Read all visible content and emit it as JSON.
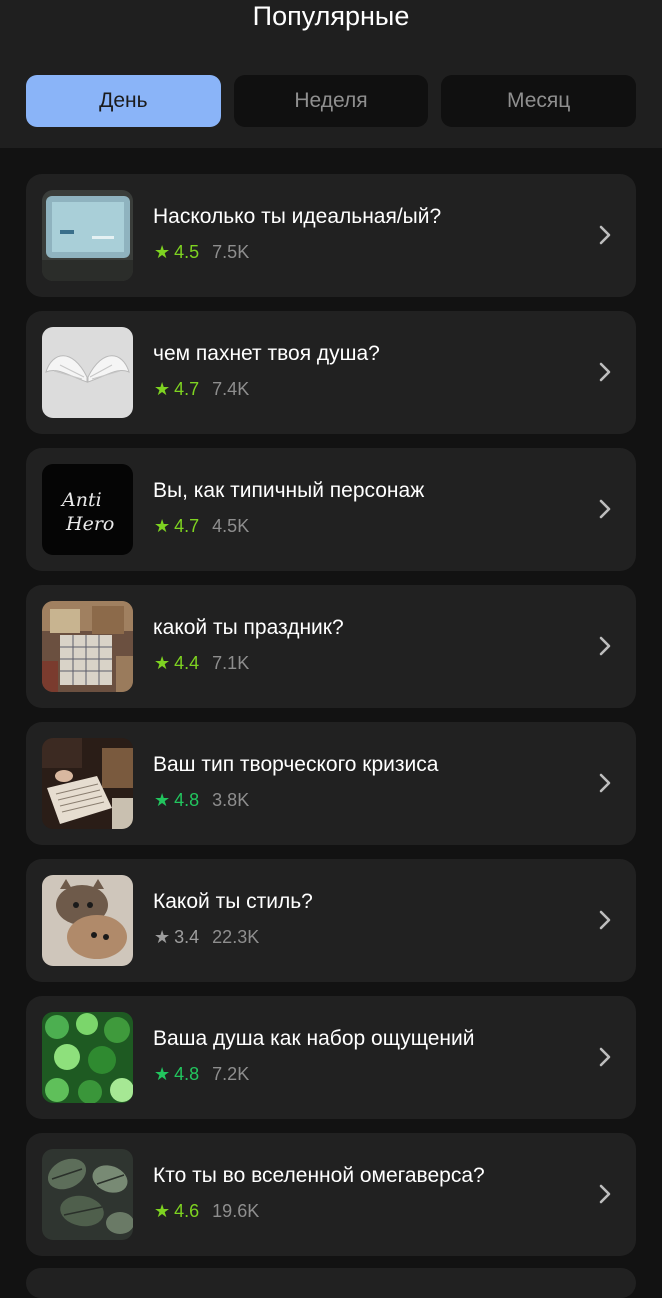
{
  "header": {
    "title": "Популярные",
    "tabs": [
      {
        "label": "День",
        "active": true
      },
      {
        "label": "Неделя",
        "active": false
      },
      {
        "label": "Месяц",
        "active": false
      }
    ]
  },
  "colors": {
    "active_tab": "#8ab4f8",
    "rating_high": "#22c55e",
    "rating_mid": "#7ed321",
    "rating_low": "#9e9e9e"
  },
  "quizzes": [
    {
      "title": "Насколько ты идеальная/ый?",
      "rating": "4.5",
      "views": "7.5K",
      "rating_color": "#7ed321",
      "image": "tv-screen-image"
    },
    {
      "title": "чем пахнет твоя душа?",
      "rating": "4.7",
      "views": "7.4K",
      "rating_color": "#7ed321",
      "image": "angel-wings-image"
    },
    {
      "title": "Вы, как типичный персонаж",
      "rating": "4.7",
      "views": "4.5K",
      "rating_color": "#7ed321",
      "image": "anti-hero-logo-image",
      "image_text": "Anti Hero"
    },
    {
      "title": "какой ты праздник?",
      "rating": "4.4",
      "views": "7.1K",
      "rating_color": "#7ed321",
      "image": "calendar-collage-image"
    },
    {
      "title": "Ваш тип творческого кризиса",
      "rating": "4.8",
      "views": "3.8K",
      "rating_color": "#22c55e",
      "image": "writing-desk-image"
    },
    {
      "title": "Какой ты стиль?",
      "rating": "3.4",
      "views": "22.3K",
      "rating_color": "#9e9e9e",
      "image": "kittens-image"
    },
    {
      "title": "Ваша душа как набор ощущений",
      "rating": "4.8",
      "views": "7.2K",
      "rating_color": "#22c55e",
      "image": "green-glass-image"
    },
    {
      "title": "Кто ты во вселенной омегаверса?",
      "rating": "4.6",
      "views": "19.6K",
      "rating_color": "#7ed321",
      "image": "monstera-leaves-image"
    }
  ]
}
